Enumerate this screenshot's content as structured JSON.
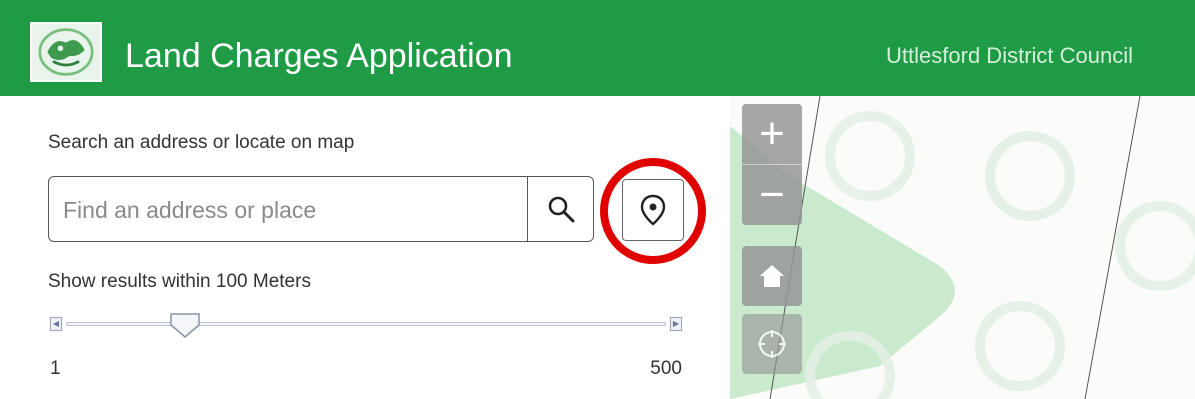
{
  "header": {
    "app_title": "Land Charges Application",
    "council_name": "Uttlesford District Council",
    "logo_icon": "council-crest-icon",
    "background_color": "#1f9a45"
  },
  "search": {
    "label": "Search an address or locate on map",
    "placeholder": "Find an address or place",
    "value": "",
    "search_icon": "search-icon",
    "locate_icon": "location-pin-icon"
  },
  "range": {
    "label": "Show results within 100 Meters",
    "min_label": "1",
    "max_label": "500",
    "value": 100,
    "min": 1,
    "max": 500
  },
  "map": {
    "zoom_in_label": "+",
    "zoom_out_label": "−",
    "home_icon": "home-icon",
    "locate_icon": "crosshair-icon"
  },
  "annotation": {
    "highlight_color": "#e10000"
  }
}
